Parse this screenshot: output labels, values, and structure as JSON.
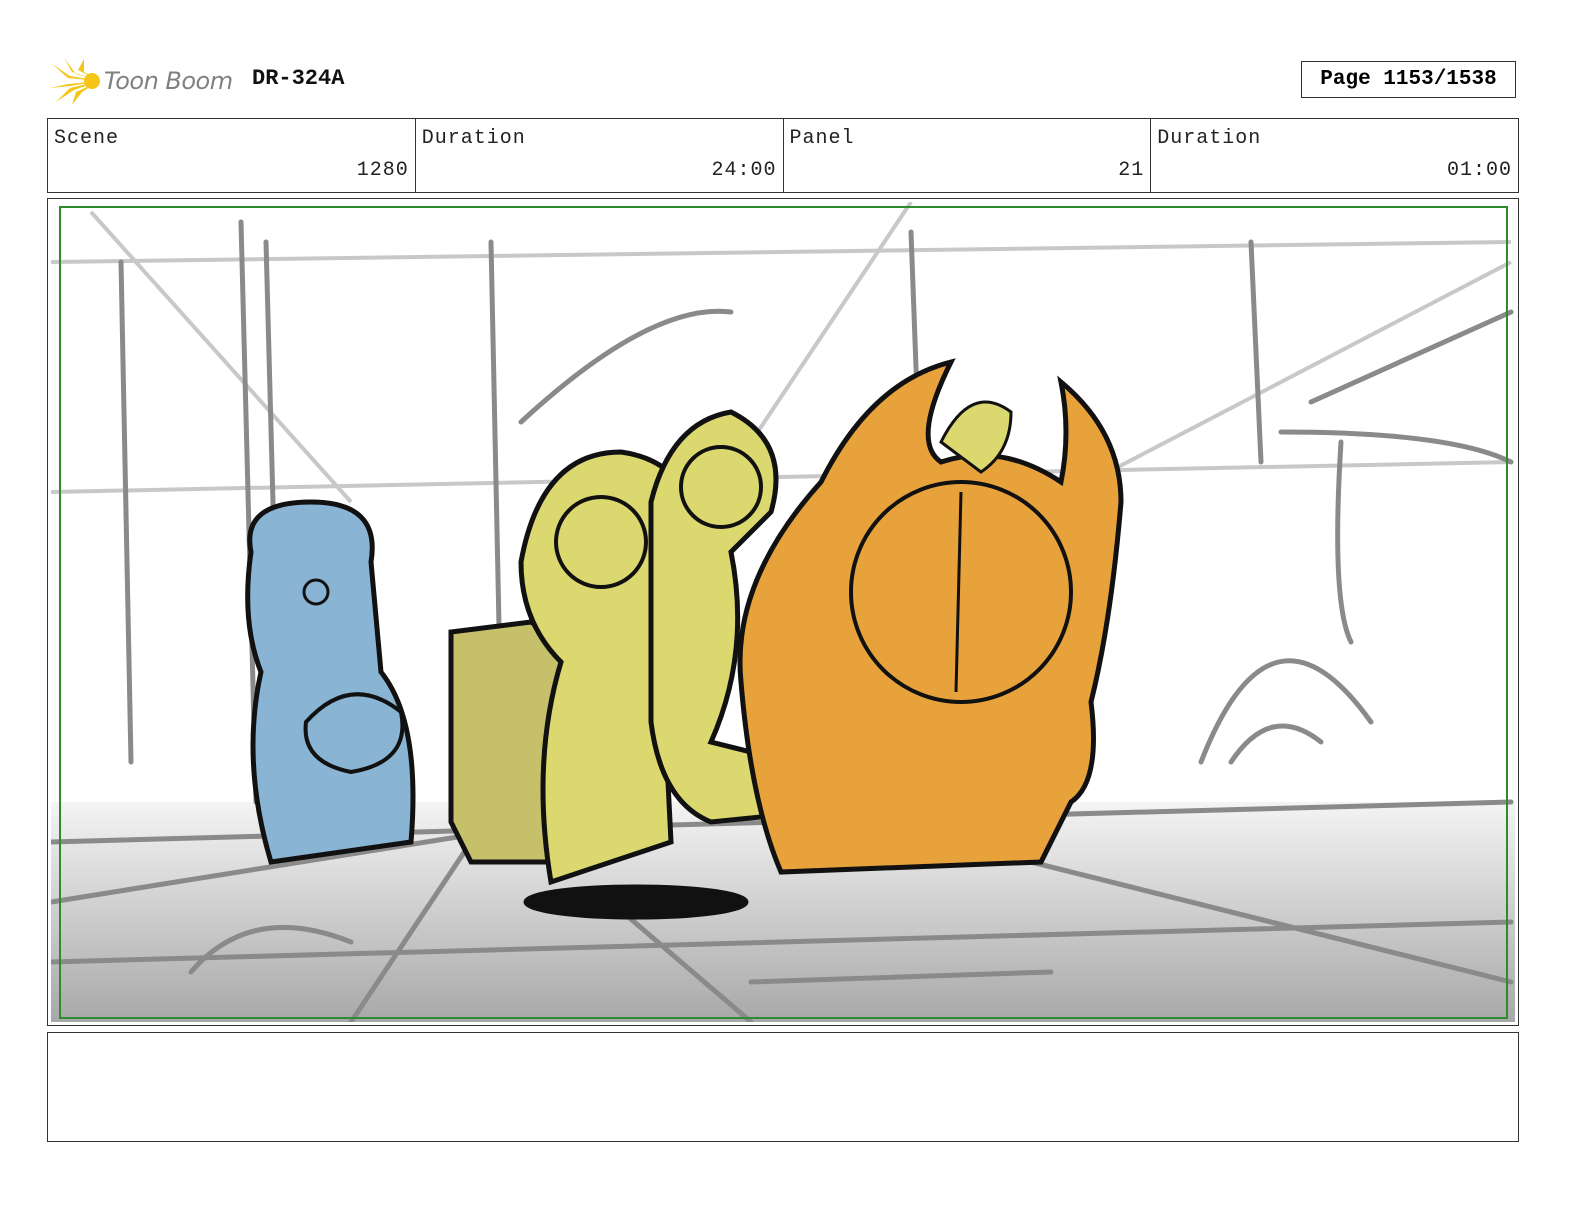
{
  "header": {
    "logo_text": "Toon Boom",
    "production_code": "DR-324A",
    "page_label": "Page 1153/1538"
  },
  "info": {
    "scene_label": "Scene",
    "scene_value": "1280",
    "scene_duration_label": "Duration",
    "scene_duration_value": "24:00",
    "panel_label": "Panel",
    "panel_value": "21",
    "panel_duration_label": "Duration",
    "panel_duration_value": "01:00"
  },
  "colors": {
    "safe_frame": "#2e8b2e",
    "character_blue": "#8ab4d4",
    "character_yellow": "#dcd870",
    "character_orange": "#e8a23c",
    "logo_star": "#f5c518"
  },
  "notes": ""
}
